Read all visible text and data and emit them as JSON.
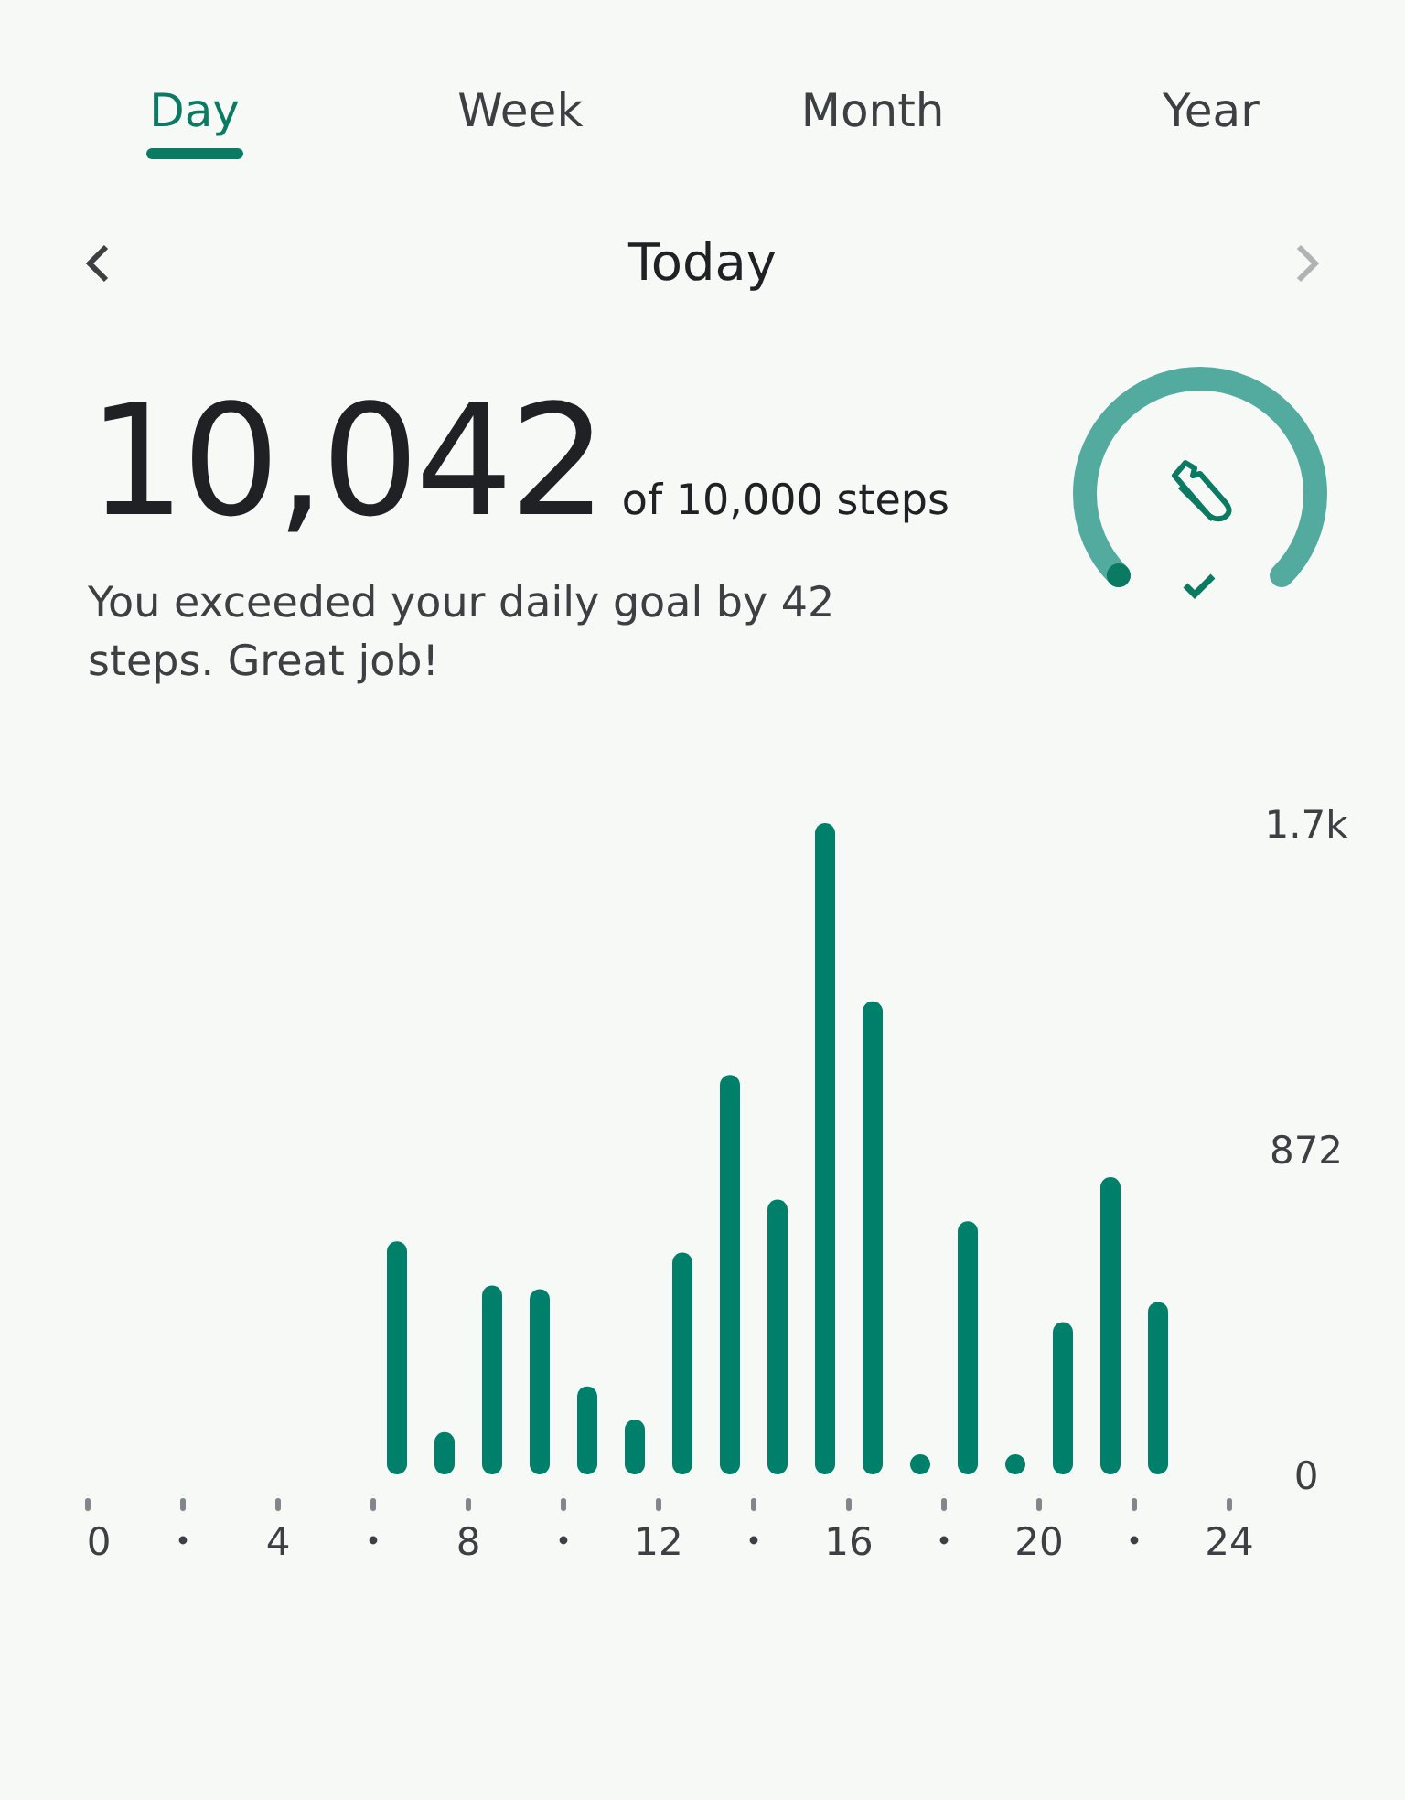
{
  "tabs": [
    {
      "label": "Day",
      "selected": true
    },
    {
      "label": "Week",
      "selected": false
    },
    {
      "label": "Month",
      "selected": false
    },
    {
      "label": "Year",
      "selected": false
    }
  ],
  "period": {
    "title": "Today",
    "prev_enabled": true,
    "next_enabled": false
  },
  "summary": {
    "steps": "10,042",
    "goal": "of 10,000 steps",
    "message": "You exceeded your daily goal by 42 steps. Great job!"
  },
  "goal_ring": {
    "goal_met": true
  },
  "chart": {
    "chart_data": {
      "type": "bar",
      "x": [
        6.5,
        7.5,
        8.5,
        9.5,
        10.5,
        11.5,
        12.5,
        13.5,
        14.5,
        15.5,
        16.5,
        17.5,
        18.5,
        19.5,
        20.5,
        21.5,
        22.5
      ],
      "series": [
        {
          "color": "#00806a",
          "values": [
            624,
            113,
            506,
            496,
            236,
            147,
            594,
            1070,
            736,
            1744,
            1267,
            49,
            678,
            49,
            408,
            796,
            462
          ]
        }
      ],
      "ylim": [
        0,
        1744
      ],
      "yticks": [
        0,
        872,
        {
          "value": 1744,
          "label": "1.7k"
        }
      ],
      "xlim": [
        0,
        24
      ],
      "xticks": [
        0,
        4,
        8,
        12,
        16,
        20,
        24
      ]
    }
  }
}
